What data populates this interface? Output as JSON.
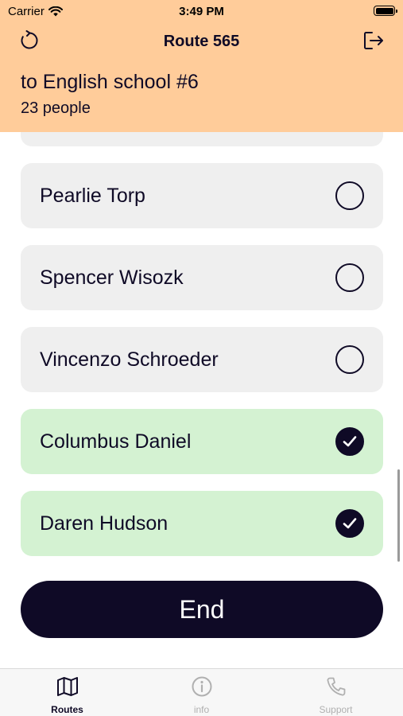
{
  "status_bar": {
    "carrier": "Carrier",
    "time": "3:49 PM"
  },
  "nav": {
    "title": "Route 565",
    "left_icon": "refresh-icon",
    "right_icon": "logout-icon"
  },
  "route": {
    "destination": "to English school #6",
    "people_count": "23 people"
  },
  "passengers": [
    {
      "name": "Pearlie Torp",
      "checked": false
    },
    {
      "name": "Spencer Wisozk",
      "checked": false
    },
    {
      "name": "Vincenzo Schroeder",
      "checked": false
    },
    {
      "name": "Columbus Daniel",
      "checked": true
    },
    {
      "name": "Daren Hudson",
      "checked": true
    }
  ],
  "end_button": {
    "label": "End"
  },
  "tabs": [
    {
      "label": "Routes",
      "icon": "map-icon",
      "active": true
    },
    {
      "label": "info",
      "icon": "info-icon",
      "active": false
    },
    {
      "label": "Support",
      "icon": "phone-icon",
      "active": false
    }
  ],
  "colors": {
    "header_bg": "#ffcc9a",
    "card_default": "#efefef",
    "card_checked": "#d4f2d2",
    "primary_dark": "#0f0a26"
  }
}
